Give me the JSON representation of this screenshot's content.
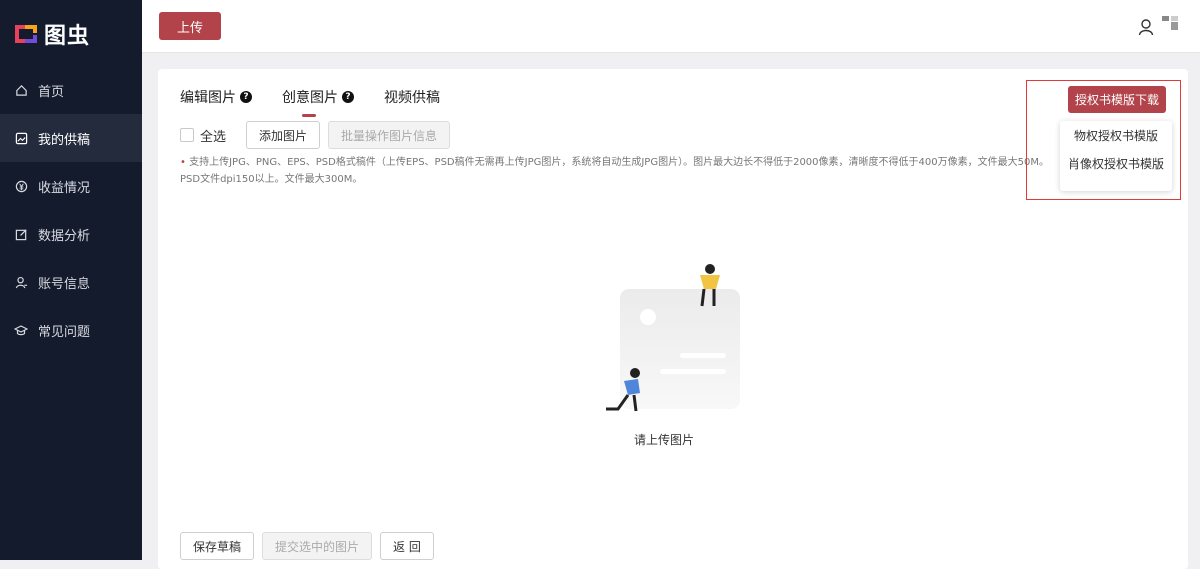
{
  "brand": {
    "name": "图虫",
    "accent": "#b2434a",
    "sidebar_bg": "#141b2d"
  },
  "sidebar": {
    "items": [
      {
        "label": "首页",
        "icon": "home-icon"
      },
      {
        "label": "我的供稿",
        "icon": "image-icon"
      },
      {
        "label": "收益情况",
        "icon": "yen-icon"
      },
      {
        "label": "数据分析",
        "icon": "edit-chart-icon"
      },
      {
        "label": "账号信息",
        "icon": "user-icon"
      },
      {
        "label": "常见问题",
        "icon": "graduation-cap-icon"
      }
    ]
  },
  "header": {
    "upload_label": "上传"
  },
  "tabs": [
    {
      "label": "编辑图片",
      "has_help": true
    },
    {
      "label": "创意图片",
      "has_help": true
    },
    {
      "label": "视频供稿",
      "has_help": false
    }
  ],
  "help_glyph": "?",
  "toolbar": {
    "select_all": "全选",
    "add_image": "添加图片",
    "batch_edit": "批量操作图片信息"
  },
  "notice": {
    "bullet": "•",
    "line1": "支持上传JPG、PNG、EPS、PSD格式稿件（上传EPS、PSD稿件无需再上传JPG图片，系统将自动生成JPG图片）。图片最大边长不得低于2000像素，清晰度不得低于400万像素，文件最大50M。",
    "line2": "PSD文件dpi150以上。文件最大300M。"
  },
  "empty_state": {
    "label": "请上传图片"
  },
  "footer": {
    "save_draft": "保存草稿",
    "submit_selected": "提交选中的图片",
    "back": "返 回"
  },
  "download": {
    "button": "授权书模版下载",
    "menu": [
      "物权授权书模版",
      "肖像权授权书模版"
    ]
  }
}
